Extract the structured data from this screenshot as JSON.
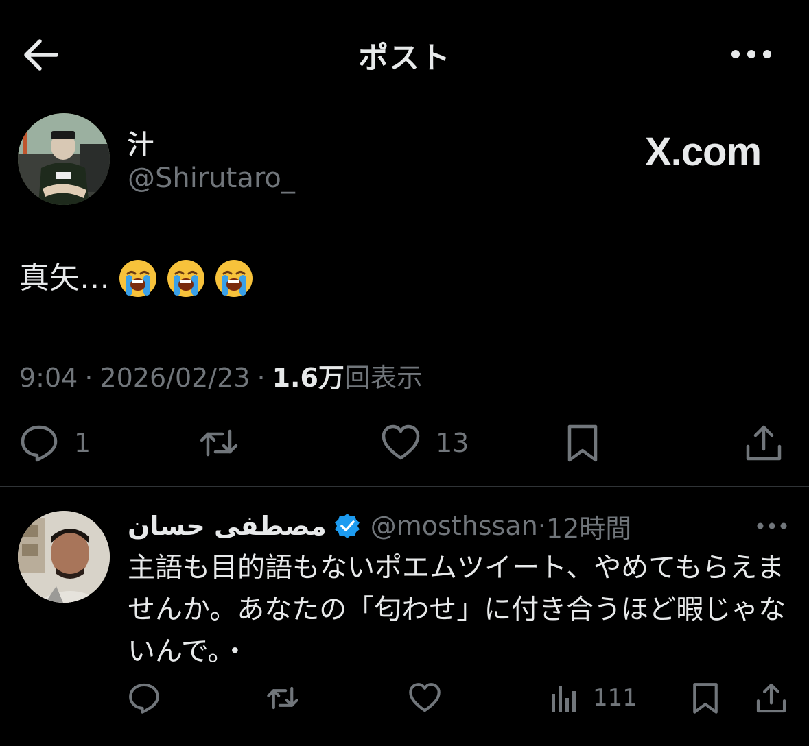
{
  "header": {
    "title": "ポスト",
    "back_icon": "arrow-left-icon",
    "more_icon": "more-horizontal-icon"
  },
  "post": {
    "author_name": "汁",
    "author_handle": "@Shirutaro_",
    "brand_logo": "X.com",
    "text": "真矢…",
    "emoji_count": 3,
    "emoji_icon": "loudly-crying-face-icon",
    "time": "9:04",
    "date": "2026/02/23",
    "views_count": "1.6万",
    "views_label": "回表示",
    "actions": {
      "reply_count": "1",
      "retweet_count": "",
      "like_count": "13"
    }
  },
  "reply": {
    "author_name": "مصطفى حسان",
    "verified": true,
    "author_handle": "@mosthssan",
    "separator": "·",
    "time": "12時間",
    "text": "主語も目的語もないポエムツイート、やめてもらえませんか。あなたの「匂わせ」に付き合うほど暇じゃないんで。・",
    "actions": {
      "views_count": "111"
    }
  },
  "colors": {
    "background": "#000000",
    "text_primary": "#e7e9ea",
    "text_secondary": "#71767b",
    "divider": "#2f3336",
    "verified_blue": "#1d9bf0"
  }
}
